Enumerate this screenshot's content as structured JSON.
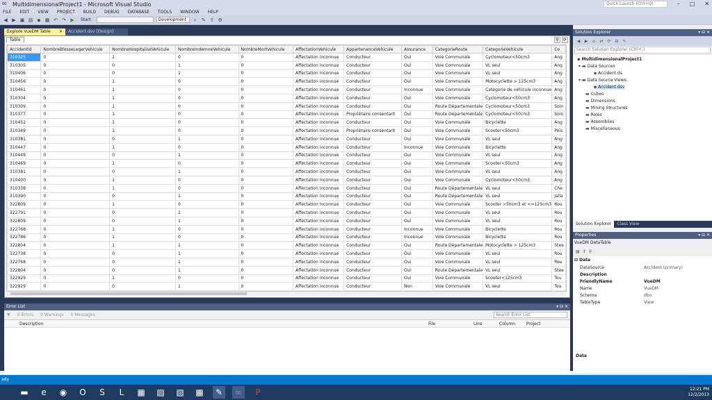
{
  "window": {
    "title": "MultidimensionalProject1 - Microsoft Visual Studio",
    "quick_launch_placeholder": "Quick Launch (Ctrl+Q)"
  },
  "menu": [
    "FILE",
    "EDIT",
    "VIEW",
    "PROJECT",
    "BUILD",
    "DEBUG",
    "DATABASE",
    "TOOLS",
    "WINDOW",
    "HELP"
  ],
  "toolbar": {
    "start_label": "Start",
    "solution_config": "Development"
  },
  "tabs": {
    "active": "Explore VueDM Table",
    "inactive": "Accident.dsv [Design]"
  },
  "doc": {
    "inner_tab": "Table",
    "columns": [
      "AccidentId",
      "NombreBlesseLegerVehicule",
      "NombreHospitaliseVehicule",
      "NombreIndemneVehicule",
      "NombreMortVehicule",
      "AffectationVehicule",
      "AppartenanceVehicule",
      "Assurance",
      "CategorieRoute",
      "CategorieVehicule",
      "Co"
    ],
    "rows": [
      [
        "310325",
        "0",
        "1",
        "0",
        "0",
        "Affectation inconnue",
        "Conducteur",
        "Oui",
        "Voie Communale",
        "Cyclomoteur<50cm3",
        "Ang"
      ],
      [
        "310305",
        "0",
        "0",
        "1",
        "0",
        "Affectation inconnue",
        "Conducteur",
        "Oui",
        "Voie Communale",
        "VL seul",
        "Ang"
      ],
      [
        "310406",
        "0",
        "0",
        "1",
        "0",
        "Affectation inconnue",
        "Conducteur",
        "Oui",
        "Voie Communale",
        "VL seul",
        "Ang"
      ],
      [
        "310456",
        "0",
        "1",
        "0",
        "0",
        "Affectation inconnue",
        "Conducteur",
        "Oui",
        "Voie Communale",
        "Motocyclette > 125cm3",
        "Ang"
      ],
      [
        "310461",
        "0",
        "1",
        "0",
        "0",
        "Affectation inconnue",
        "Conducteur",
        "Inconnue",
        "Voie Communale",
        "Catégorie de véhicule inconnue",
        "Ang"
      ],
      [
        "310304",
        "0",
        "1",
        "0",
        "0",
        "Affectation inconnue",
        "Conducteur",
        "Oui",
        "Voie Communale",
        "Cyclomoteur<50cm3",
        "Ang"
      ],
      [
        "310309",
        "0",
        "1",
        "0",
        "0",
        "Affectation inconnue",
        "Conducteur",
        "Oui",
        "Route Départementale",
        "Cyclomoteur<50cm3",
        "Soin"
      ],
      [
        "310377",
        "0",
        "1",
        "0",
        "0",
        "Affectation inconnue",
        "Propriétaire consentant",
        "Oui",
        "Route Départementale",
        "Cyclomoteur<50cm3",
        "Soin"
      ],
      [
        "310452",
        "0",
        "1",
        "0",
        "0",
        "Affectation inconnue",
        "Conducteur",
        "Oui",
        "Voie Communale",
        "Bicyclette",
        "Ang"
      ],
      [
        "310349",
        "0",
        "1",
        "0",
        "0",
        "Affectation inconnue",
        "Propriétaire consentant",
        "Oui",
        "Voie Communale",
        "Scooter<50cm3",
        "Pois"
      ],
      [
        "310381",
        "0",
        "0",
        "1",
        "0",
        "Affectation inconnue",
        "Conducteur",
        "Oui",
        "Voie Communale",
        "VL seul",
        "Ang"
      ],
      [
        "310447",
        "0",
        "1",
        "0",
        "0",
        "Affectation inconnue",
        "Conducteur",
        "Inconnue",
        "Voie Communale",
        "Bicyclette",
        "Ang"
      ],
      [
        "310449",
        "0",
        "0",
        "1",
        "0",
        "Affectation inconnue",
        "Conducteur",
        "Oui",
        "Voie Communale",
        "VL seul",
        "Ang"
      ],
      [
        "310469",
        "0",
        "1",
        "0",
        "0",
        "Affectation inconnue",
        "Conducteur",
        "Oui",
        "Voie Communale",
        "Scooter<50cm3",
        "Ang"
      ],
      [
        "310381",
        "0",
        "0",
        "1",
        "0",
        "Affectation inconnue",
        "Conducteur",
        "Oui",
        "Voie Communale",
        "VL seul",
        "Ang"
      ],
      [
        "310400",
        "0",
        "1",
        "0",
        "0",
        "Affectation inconnue",
        "Conducteur",
        "Oui",
        "Voie Communale",
        "Cyclomoteur<50cm3",
        "Ang"
      ],
      [
        "310338",
        "0",
        "1",
        "0",
        "0",
        "Affectation inconnue",
        "Conducteur",
        "Oui",
        "Route Départementale",
        "VL seul",
        "Che"
      ],
      [
        "310390",
        "0",
        "0",
        "1",
        "0",
        "Affectation inconnue",
        "Conducteur",
        "Oui",
        "Route Départementale",
        "VL seul",
        "Jalla"
      ],
      [
        "322809",
        "0",
        "1",
        "0",
        "0",
        "Affectation inconnue",
        "Conducteur",
        "Oui",
        "Voie Communale",
        "Scooter >50cm3 et <=125cm3",
        "Rou"
      ],
      [
        "322791",
        "0",
        "0",
        "1",
        "0",
        "Affectation inconnue",
        "Conducteur",
        "Oui",
        "Voie Communale",
        "VL seul",
        "Rou"
      ],
      [
        "322809",
        "0",
        "0",
        "1",
        "0",
        "Affectation inconnue",
        "Conducteur",
        "Oui",
        "Voie Communale",
        "VL seul",
        "Rou"
      ],
      [
        "322768",
        "0",
        "1",
        "0",
        "0",
        "Affectation inconnue",
        "Conducteur",
        "Inconnue",
        "Voie Communale",
        "Bicyclette",
        "Rou"
      ],
      [
        "322786",
        "0",
        "1",
        "0",
        "0",
        "Affectation inconnue",
        "Conducteur",
        "Inconnue",
        "Voie Communale",
        "Bicyclette",
        "Rou"
      ],
      [
        "322804",
        "0",
        "1",
        "1",
        "0",
        "Affectation inconnue",
        "Conducteur",
        "Oui",
        "Route Départementale",
        "Motocyclette > 125cm3",
        "Stee"
      ],
      [
        "322738",
        "0",
        "0",
        "1",
        "0",
        "Affectation inconnue",
        "Conducteur",
        "Oui",
        "Voie Communale",
        "VL seul",
        "Rou"
      ],
      [
        "322768",
        "0",
        "0",
        "1",
        "0",
        "Affectation inconnue",
        "Conducteur",
        "Oui",
        "Voie Communale",
        "VL seul",
        "Rou"
      ],
      [
        "322804",
        "0",
        "0",
        "1",
        "0",
        "Affectation inconnue",
        "Conducteur",
        "Oui",
        "Route Départementale",
        "VL seul",
        "Stee"
      ],
      [
        "322929",
        "0",
        "1",
        "0",
        "0",
        "Affectation inconnue",
        "Conducteur",
        "Oui",
        "Voie Communale",
        "Scooter<125cm3",
        "Tou"
      ],
      [
        "322929",
        "0",
        "0",
        "1",
        "0",
        "Affectation inconnue",
        "Conducteur",
        "Non",
        "Voie Communale",
        "VL seul",
        "Tou"
      ]
    ]
  },
  "error_list": {
    "title": "Error List",
    "errors": "0 Errors",
    "warnings": "0 Warnings",
    "messages": "0 Messages",
    "search_placeholder": "Search Error List",
    "columns": [
      "Description",
      "File",
      "Line",
      "Column",
      "Project"
    ]
  },
  "solution_explorer": {
    "title": "Solution Explorer",
    "search_placeholder": "Search Solution Explorer (Ctrl+;)",
    "items": [
      "MultidimensionalProject1",
      "Data Sources",
      "Accident.ds",
      "Data Source Views",
      "Accident.dsv",
      "Cubes",
      "Dimensions",
      "Mining Structures",
      "Roles",
      "Assemblies",
      "Miscellaneous"
    ],
    "tab_active": "Solution Explorer",
    "tab_inactive": "Class View"
  },
  "properties": {
    "title": "Properties",
    "object": "VueDM DataTable",
    "category": "Data",
    "rows": [
      [
        "DataSource",
        "Accident (primary)"
      ],
      [
        "Description",
        ""
      ],
      [
        "FriendlyName",
        "VueDM"
      ],
      [
        "Name",
        "VueDM"
      ],
      [
        "Schema",
        "dbo"
      ],
      [
        "TableType",
        "View"
      ]
    ],
    "desc_title": "Data"
  },
  "statusbar": {
    "text": "ady"
  },
  "taskbar": {
    "time": "12:21 PM",
    "date": "12/2/2013"
  }
}
